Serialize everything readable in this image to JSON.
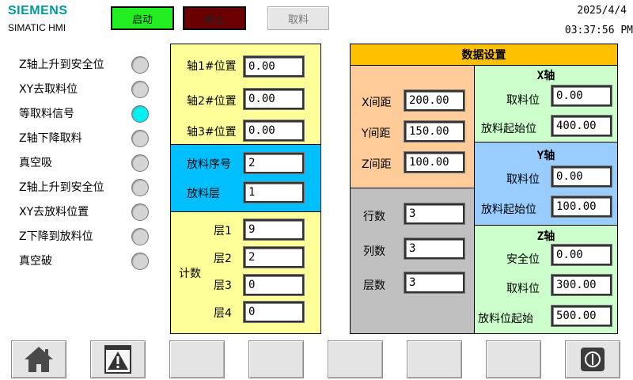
{
  "header": {
    "brand": "SIEMENS",
    "product": "SIMATIC HMI",
    "date": "2025/4/4",
    "time": "03:37:56 PM",
    "buttons": {
      "start": "启动",
      "stop": "停止",
      "take": "取料"
    }
  },
  "steps": [
    {
      "label": "Z轴上升到安全位",
      "active": false
    },
    {
      "label": "XY去取料位",
      "active": false
    },
    {
      "label": "等取料信号",
      "active": true
    },
    {
      "label": "Z轴下降取料",
      "active": false
    },
    {
      "label": "真空吸",
      "active": false
    },
    {
      "label": "Z轴上升到安全位",
      "active": false
    },
    {
      "label": "XY去放料位置",
      "active": false
    },
    {
      "label": "Z下降到放料位",
      "active": false
    },
    {
      "label": "真空破",
      "active": false
    }
  ],
  "axis_positions": {
    "axis1_label": "轴1#位置",
    "axis1_value": "0.00",
    "axis2_label": "轴2#位置",
    "axis2_value": "0.00",
    "axis3_label": "轴3#位置",
    "axis3_value": "0.00"
  },
  "placement": {
    "seq_label": "放料序号",
    "seq_value": "2",
    "layer_label": "放料层",
    "layer_value": "1"
  },
  "counts": {
    "title": "计数",
    "l1_label": "层1",
    "l1_value": "9",
    "l2_label": "层2",
    "l2_value": "2",
    "l3_label": "层3",
    "l3_value": "0",
    "l4_label": "层4",
    "l4_value": "0"
  },
  "settings": {
    "title": "数据设置",
    "spacing": {
      "x_label": "X间距",
      "x_value": "200.00",
      "y_label": "Y间距",
      "y_value": "150.00",
      "z_label": "Z间距",
      "z_value": "100.00"
    },
    "grid": {
      "rows_label": "行数",
      "rows_value": "3",
      "cols_label": "列数",
      "cols_value": "3",
      "layers_label": "层数",
      "layers_value": "3"
    },
    "x_axis": {
      "title": "X轴",
      "pick_label": "取料位",
      "pick_value": "0.00",
      "place_label": "放料起始位",
      "place_value": "400.00"
    },
    "y_axis": {
      "title": "Y轴",
      "pick_label": "取料位",
      "pick_value": "0.00",
      "place_label": "放料起始位",
      "place_value": "100.00"
    },
    "z_axis": {
      "title": "Z轴",
      "safe_label": "安全位",
      "safe_value": "0.00",
      "pick_label": "取料位",
      "pick_value": "300.00",
      "place_label": "放料位起始",
      "place_value": "500.00"
    }
  },
  "nav_icons": [
    "home-icon",
    "alarm-warning-icon",
    "",
    "",
    "",
    "",
    "",
    "power-icon"
  ],
  "colors": {
    "brand": "#009999",
    "start": "#22ee22",
    "stop": "#6b0000",
    "lamp_active": "#00f0f0",
    "panel_yellow": "#ffff99",
    "panel_cyan": "#00bfff",
    "title_orange": "#ffc000",
    "spacing_peach": "#ffcc99",
    "grid_gray": "#c0c0c0",
    "axis_green": "#ccffcc",
    "axis_blue": "#99ccff"
  }
}
